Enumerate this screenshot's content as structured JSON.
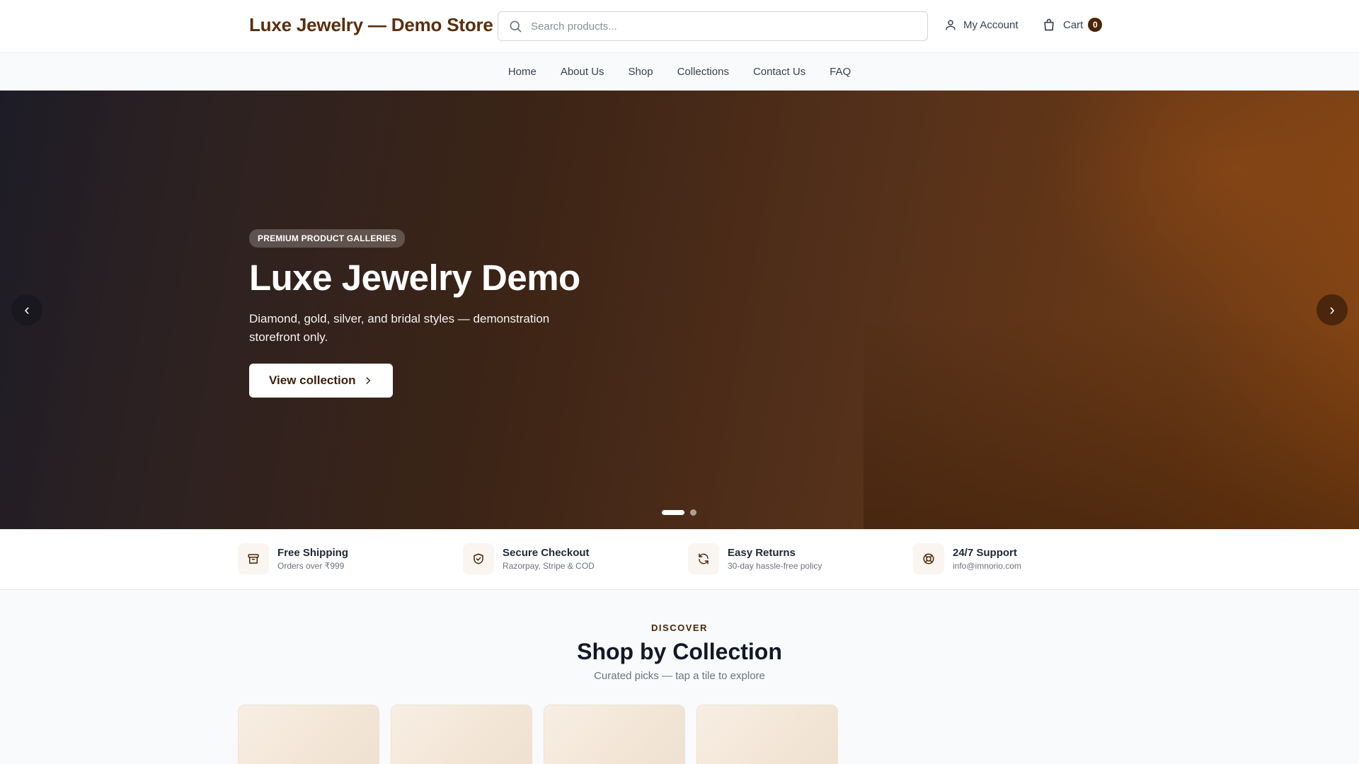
{
  "header": {
    "logo": "Luxe Jewelry — Demo Store",
    "search_placeholder": "Search products...",
    "account_label": "My Account",
    "cart_label": "Cart",
    "cart_count": "0"
  },
  "nav": {
    "items": [
      "Home",
      "About Us",
      "Shop",
      "Collections",
      "Contact Us",
      "FAQ"
    ]
  },
  "hero": {
    "pill": "PREMIUM PRODUCT GALLERIES",
    "title": "Luxe Jewelry Demo",
    "subtitle": "Diamond, gold, silver, and bridal styles — demonstration storefront only.",
    "cta": "View collection",
    "prev_symbol": "‹",
    "next_symbol": "›",
    "slide_count": 2,
    "active_slide": 1
  },
  "features": [
    {
      "title": "Free Shipping",
      "sub": "Orders over ₹999",
      "icon": "box-icon"
    },
    {
      "title": "Secure Checkout",
      "sub": "Razorpay, Stripe & COD",
      "icon": "shield-check-icon"
    },
    {
      "title": "Easy Returns",
      "sub": "30-day hassle-free policy",
      "icon": "refresh-icon"
    },
    {
      "title": "24/7 Support",
      "sub": "info@imnorio.com",
      "icon": "lifebuoy-icon"
    }
  ],
  "collections": {
    "eyebrow": "DISCOVER",
    "title": "Shop by Collection",
    "subtitle": "Curated picks — tap a tile to explore",
    "tile_count": 4
  },
  "colors": {
    "brand": "#5a2e0c",
    "accent_dark": "#4a2507"
  }
}
